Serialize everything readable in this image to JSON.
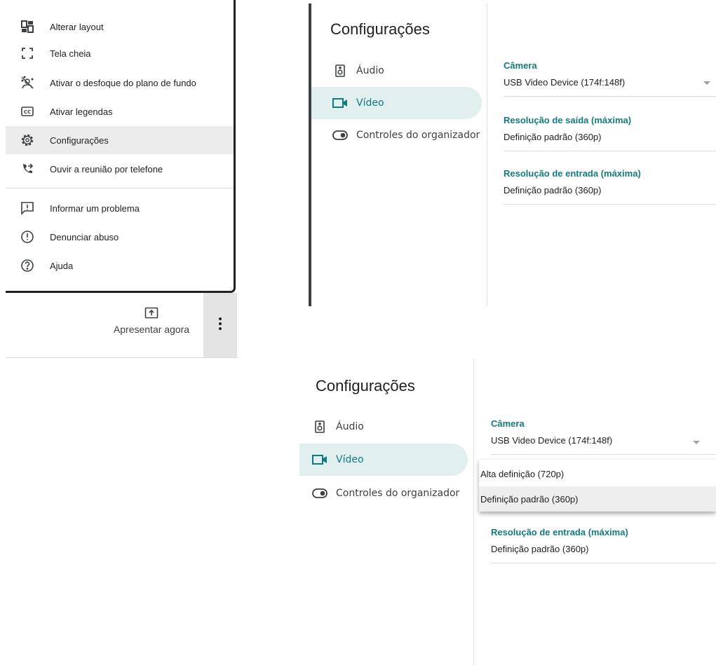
{
  "menu": {
    "items": [
      {
        "label": "Alterar layout",
        "icon": "layout-icon"
      },
      {
        "label": "Tela cheia",
        "icon": "fullscreen-icon"
      },
      {
        "label": "Ativar o desfoque do plano de fundo",
        "icon": "background-blur-icon"
      },
      {
        "label": "Ativar legendas",
        "icon": "closed-captions-icon"
      },
      {
        "label": "Configurações",
        "icon": "gear-icon"
      },
      {
        "label": "Ouvir a reunião por telefone",
        "icon": "phone-forward-icon"
      },
      {
        "label": "Informar um problema",
        "icon": "feedback-icon"
      },
      {
        "label": "Denunciar abuso",
        "icon": "alert-circle-icon"
      },
      {
        "label": "Ajuda",
        "icon": "help-circle-icon"
      }
    ],
    "active_item": "Configurações"
  },
  "bottom_bar": {
    "present_label": "Apresentar agora",
    "present_icon": "present-screen-icon",
    "more_icon": "more-vert-icon"
  },
  "settings": {
    "title": "Configurações",
    "nav": [
      {
        "label": "Áudio",
        "icon": "speaker-icon"
      },
      {
        "label": "Vídeo",
        "icon": "videocam-icon",
        "selected": true
      },
      {
        "label": "Controles do organizador",
        "icon": "toggle-icon"
      }
    ],
    "fields": {
      "camera": {
        "label": "Câmera",
        "value": "USB Video Device (174f:148f)"
      },
      "output_resolution": {
        "label": "Resolução de saída (máxima)",
        "value": "Definição padrão (360p)"
      },
      "input_resolution": {
        "label": "Resolução de entrada (máxima)",
        "value": "Definição padrão (360p)"
      }
    },
    "dropdown_options": [
      "Alta definição (720p)",
      "Definição padrão (360p)"
    ],
    "dropdown_selected": "Definição padrão (360p)"
  },
  "colors": {
    "accent": "#137a7f",
    "selected_bg": "#e1efef"
  }
}
